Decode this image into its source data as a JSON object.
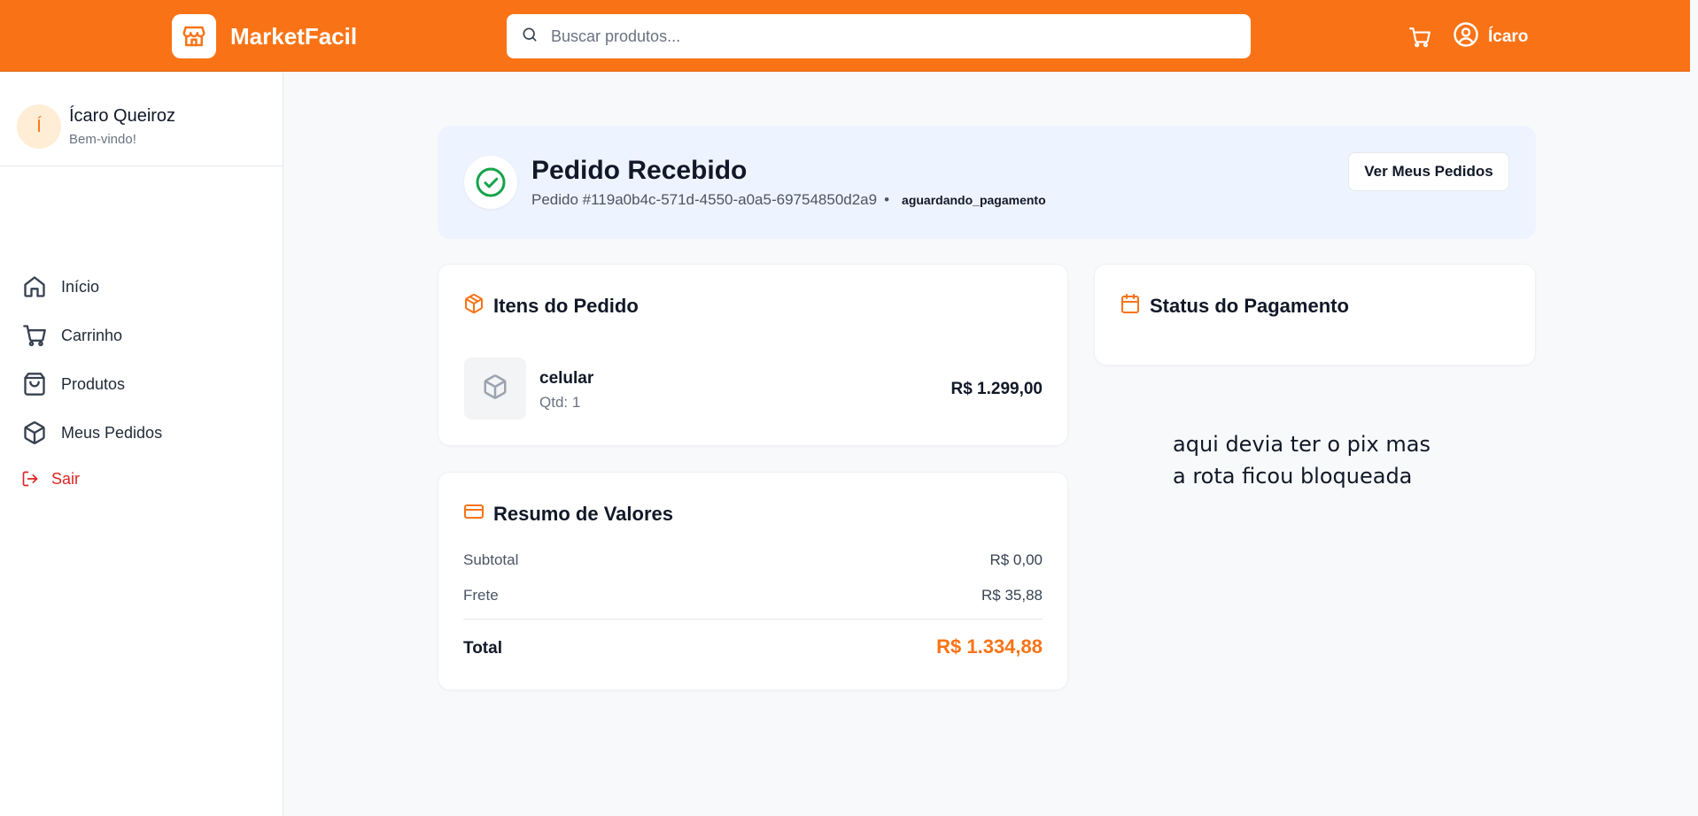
{
  "header": {
    "brand": "MarketFacil",
    "search_placeholder": "Buscar produtos...",
    "user_name": "Ícaro",
    "brand_color": "#f97316"
  },
  "sidebar": {
    "avatar_initial": "Í",
    "user_name": "Ícaro Queiroz",
    "welcome": "Bem-vindo!",
    "items": [
      {
        "label": "Início",
        "icon": "home-icon"
      },
      {
        "label": "Carrinho",
        "icon": "cart-icon"
      },
      {
        "label": "Produtos",
        "icon": "shopping-bag-icon"
      },
      {
        "label": "Meus Pedidos",
        "icon": "package-icon"
      },
      {
        "label": "Sair",
        "icon": "logout-icon"
      }
    ]
  },
  "order": {
    "title": "Pedido Recebido",
    "number": "Pedido #119a0b4c-571d-4550-a0a5-69754850d2a9",
    "separator": "•",
    "status": "aguardando_pagamento",
    "view_orders_label": "Ver Meus Pedidos"
  },
  "items_card": {
    "title": "Itens do Pedido",
    "items": [
      {
        "name": "celular",
        "qty": "Qtd: 1",
        "price": "R$ 1.299,00"
      }
    ]
  },
  "summary": {
    "title": "Resumo de Valores",
    "subtotal_label": "Subtotal",
    "subtotal_value": "R$ 0,00",
    "shipping_label": "Frete",
    "shipping_value": "R$ 35,88",
    "total_label": "Total",
    "total_value": "R$ 1.334,88"
  },
  "payment": {
    "title": "Status do Pagamento"
  },
  "note": {
    "line1": "aqui devia ter o pix mas",
    "line2": "a rota ficou bloqueada"
  }
}
